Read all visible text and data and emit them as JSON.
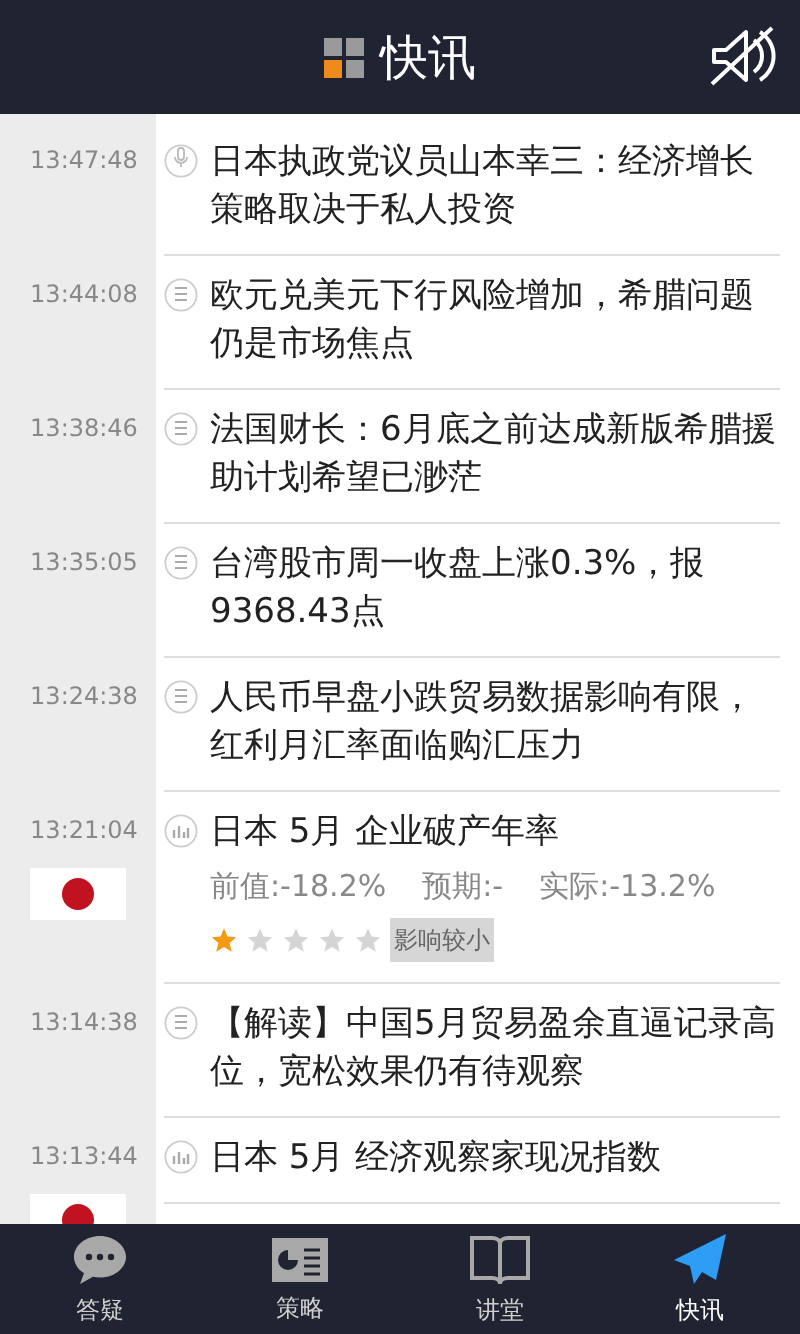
{
  "header": {
    "title": "快讯"
  },
  "items": [
    {
      "kind": "speech",
      "time": "13:47:48",
      "headline": "日本执政党议员山本幸三：经济增长策略取决于私人投资"
    },
    {
      "kind": "news",
      "time": "13:44:08",
      "headline": "欧元兑美元下行风险增加，希腊问题仍是市场焦点"
    },
    {
      "kind": "news",
      "time": "13:38:46",
      "headline": "法国财长：6月底之前达成新版希腊援助计划希望已渺茫"
    },
    {
      "kind": "news",
      "time": "13:35:05",
      "headline": "台湾股市周一收盘上涨0.3%，报9368.43点"
    },
    {
      "kind": "news",
      "time": "13:24:38",
      "headline": "人民币早盘小跌贸易数据影响有限，红利月汇率面临购汇压力"
    },
    {
      "kind": "data",
      "time": "13:21:04",
      "headline": "日本 5月 企业破产年率",
      "previous": "前值:-18.2%",
      "forecast": "预期:-",
      "actual": "实际:-13.2%",
      "stars": 1,
      "impact": "影响较小"
    },
    {
      "kind": "news",
      "time": "13:14:38",
      "headline": "【解读】中国5月贸易盈余直逼记录高位，宽松效果仍有待观察"
    },
    {
      "kind": "data",
      "time": "13:13:44",
      "headline": "日本 5月 经济观察家现况指数"
    }
  ],
  "tabs": [
    {
      "label": "答疑",
      "selected": false
    },
    {
      "label": "策略",
      "selected": false
    },
    {
      "label": "讲堂",
      "selected": false
    },
    {
      "label": "快讯",
      "selected": true
    }
  ]
}
